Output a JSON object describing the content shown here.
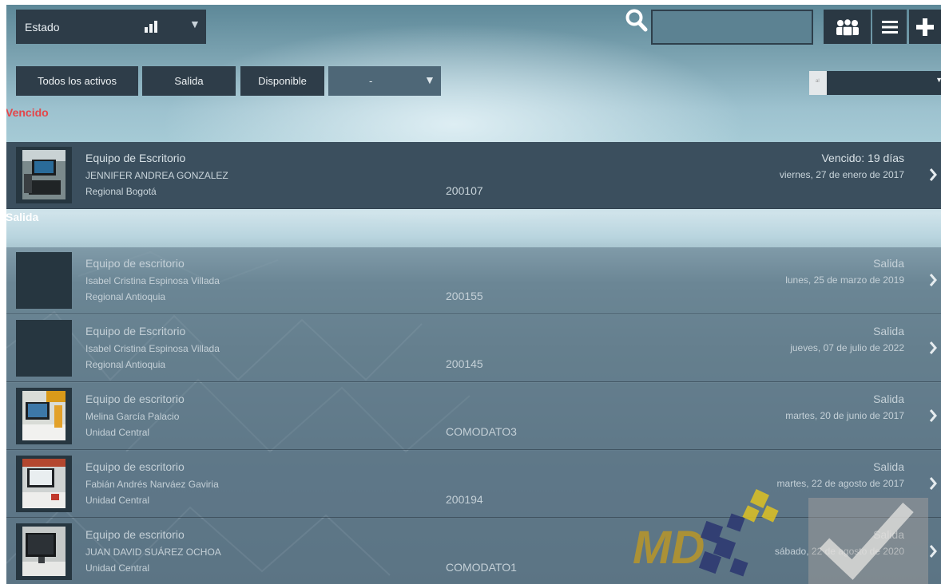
{
  "header": {
    "estado_select": {
      "label": "Estado",
      "chart_icon": "bar-chart-icon",
      "arrow_icon": "triangle-down-icon"
    },
    "search": {
      "icon": "search-icon",
      "value": "",
      "placeholder": ""
    },
    "buttons": [
      {
        "name": "users-button",
        "icon": "users-icon"
      },
      {
        "name": "menu-button",
        "icon": "hamburger-menu-icon"
      },
      {
        "name": "add-button",
        "icon": "plus-icon"
      }
    ]
  },
  "filters": {
    "all_label": "Todos los activos",
    "salida_label": "Salida",
    "disponible_label": "Disponible",
    "dash_select_value": "-",
    "right_select_value": ""
  },
  "colors": {
    "vencido_label": "#e4464a",
    "salida_label": "#ffffff",
    "dark_button": "#2e3d49",
    "card_vencido": "#3b4f5e"
  },
  "sections": {
    "vencido": {
      "label": "Vencido",
      "items": [
        {
          "type": "Equipo de Escritorio",
          "person": "JENNIFER ANDREA GONZALEZ",
          "region": "Regional Bogotá",
          "code": "200107",
          "status": "Vencido: 19 días",
          "date": "viernes, 27 de enero de 2017",
          "has_photo": true
        }
      ]
    },
    "salida": {
      "label": "Salida",
      "items": [
        {
          "type": "Equipo de escritorio",
          "person": "Isabel Cristina Espinosa Villada",
          "region": "Regional Antioquia",
          "code": "200155",
          "status": "Salida",
          "date": "lunes, 25 de marzo de 2019",
          "has_photo": false
        },
        {
          "type": "Equipo de Escritorio",
          "person": "Isabel Cristina Espinosa Villada",
          "region": "Regional Antioquia",
          "code": "200145",
          "status": "Salida",
          "date": "jueves, 07 de julio de 2022",
          "has_photo": false
        },
        {
          "type": "Equipo de escritorio",
          "person": "Melina  García Palacio",
          "region": "Unidad Central",
          "code": "COMODATO3",
          "status": "Salida",
          "date": "martes, 20 de junio de 2017",
          "has_photo": true
        },
        {
          "type": "Equipo de escritorio",
          "person": "Fabián  Andrés Narváez Gaviria",
          "region": "Unidad Central",
          "code": "200194",
          "status": "Salida",
          "date": "martes, 22 de agosto de 2017",
          "has_photo": true
        },
        {
          "type": "Equipo de escritorio",
          "person": "JUAN DAVID SUÁREZ OCHOA",
          "region": "Unidad Central",
          "code": "COMODATO1",
          "status": "Salida",
          "date": "sábado, 22 de agosto de 2020",
          "has_photo": true
        }
      ]
    }
  },
  "watermark": {
    "logo_text": "MD"
  }
}
